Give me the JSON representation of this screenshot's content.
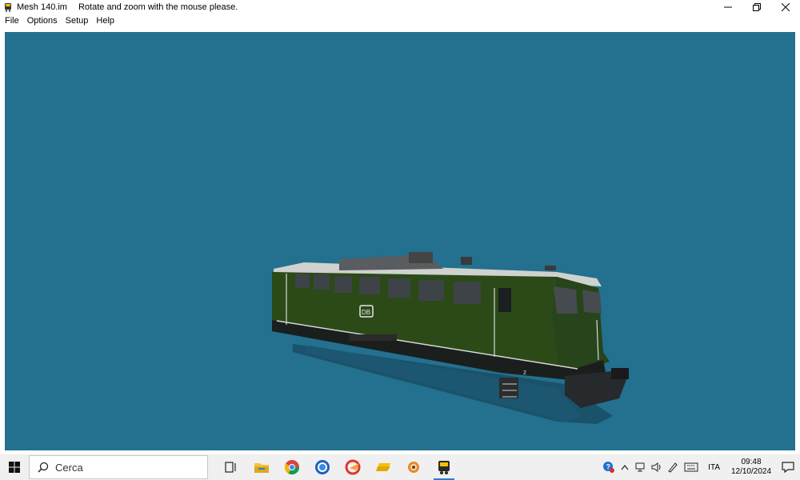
{
  "window": {
    "title": "Mesh 140.im",
    "subtitle": "Rotate and zoom with the mouse please.",
    "icon": "train-icon"
  },
  "menu": {
    "items": [
      {
        "label": "File"
      },
      {
        "label": "Options"
      },
      {
        "label": "Setup"
      },
      {
        "label": "Help"
      }
    ]
  },
  "viewport": {
    "background": "#23708f",
    "locomotive_color": "#2b4a17",
    "livery_logo": "DB",
    "cab_number": "2"
  },
  "taskbar": {
    "search_placeholder": "Cerca",
    "apps": [
      {
        "icon": "task-view-icon"
      },
      {
        "icon": "file-explorer-icon"
      },
      {
        "icon": "chrome-icon"
      },
      {
        "icon": "firefox-icon"
      },
      {
        "icon": "ccleaner-icon"
      },
      {
        "icon": "folder-icon"
      },
      {
        "icon": "app-icon"
      },
      {
        "icon": "train-app-icon",
        "active": true
      }
    ],
    "language": "ITA",
    "time": "09:48",
    "date": "12/10/2024"
  }
}
